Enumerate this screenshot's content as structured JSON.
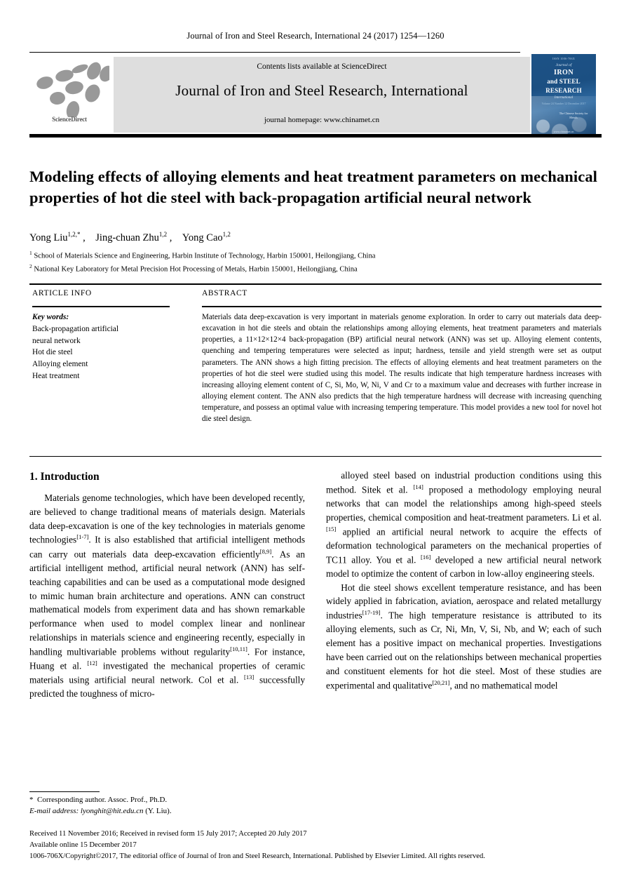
{
  "running_head": "Journal of Iron and Steel Research, International 24 (2017) 1254—1260",
  "masthead": {
    "sciencedirect_label": "ScienceDirect",
    "contents_line": "Contents lists available at ScienceDirect",
    "journal_name": "Journal of Iron and Steel Research, International",
    "homepage_line": "journal homepage: www.chinamet.cn",
    "cover": {
      "tiny_top": "ISSN 1006-706X",
      "journal_word": "Journal of",
      "line1": "IRON",
      "line2": "and STEEL",
      "line3": "RESEARCH",
      "subtitle": "International",
      "subtitle2": "Volume 24  Number 12  December 2017",
      "badge": "The Chinese Society for Metals",
      "footer": "www.chinamet.cn"
    },
    "band_color": "#dedede",
    "cover_color": "#1b4f82"
  },
  "article": {
    "title": "Modeling effects of alloying elements and heat treatment parameters on mechanical properties of hot die steel with back-propagation artificial neural network",
    "authors_html": "Yong Liu<sup>1,2,*</sup> , Jing-chuan Zhu<sup>1,2</sup> , Yong Cao<sup>1,2</sup>",
    "affiliations_html": "<sup>1</sup> School of Materials Science and Engineering, Harbin Institute of Technology, Harbin 150001, Heilongjiang, China<br><sup>2</sup> National Key Laboratory for Metal Precision Hot Processing of Metals, Harbin 150001, Heilongjiang, China"
  },
  "info_block": {
    "article_info_label": "ARTICLE INFO",
    "abstract_label": "ABSTRACT",
    "keywords_heading": "Key words:",
    "keywords": [
      "Back-propagation artificial",
      "neural network",
      "Hot die steel",
      "Alloying element",
      "Heat treatment"
    ],
    "abstract": "Materials data deep-excavation is very important in materials genome exploration. In order to carry out materials data deep-excavation in hot die steels and obtain the relationships among alloying elements, heat treatment parameters and materials properties, a 11×12×12×4 back-propagation (BP) artificial neural network (ANN) was set up. Alloying element contents, quenching and tempering temperatures were selected as input; hardness, tensile and yield strength were set as output parameters. The ANN shows a high fitting precision. The effects of alloying elements and heat treatment parameters on the properties of hot die steel were studied using this model. The results indicate that high temperature hardness increases with increasing alloying element content of C, Si, Mo, W, Ni, V and Cr to a maximum value and decreases with further increase in alloying element content. The ANN also predicts that the high temperature hardness will decrease with increasing quenching temperature, and possess an optimal value with increasing tempering temperature. This model provides a new tool for novel hot die steel design."
  },
  "body": {
    "section_heading": "1. Introduction",
    "left_paragraphs_html": [
      "Materials genome technologies, which have been developed recently, are believed to change traditional means of materials design. Materials data deep-excavation is one of the key technologies in materials genome technologies<sup>[1-7]</sup>. It is also established that artificial intelligent methods can carry out materials data deep-excavation efficiently<sup>[8,9]</sup>. As an artificial intelligent method, artificial neural network (ANN) has self-teaching capabilities and can be used as a computational mode designed to mimic human brain architecture and operations. ANN can construct mathematical models from experiment data and has shown remarkable performance when used to model complex linear and nonlinear relationships in materials science and engineering recently, especially in handling multivariable problems without regularity<sup>[10,11]</sup>. For instance, Huang et al. <sup>[12]</sup> investigated the mechanical properties of ceramic materials using artificial neural network. Col et al. <sup>[13]</sup> successfully predicted the toughness of micro-"
    ],
    "right_paragraphs_html": [
      "alloyed steel based on industrial production conditions using this method. Sitek et al. <sup>[14]</sup> proposed a methodology employing neural networks that can model the relationships among high-speed steels properties, chemical composition and heat-treatment parameters. Li et al. <sup>[15]</sup> applied an artificial neural network to acquire the effects of deformation technological parameters on the mechanical properties of TC11 alloy. You et al. <sup>[16]</sup> developed a new artificial neural network model to optimize the content of carbon in low-alloy engineering steels.",
      "Hot die steel shows excellent temperature resistance, and has been widely applied in fabrication, aviation, aerospace and related metallurgy industries<sup>[17-19]</sup>. The high temperature resistance is attributed to its alloying elements, such as Cr, Ni, Mn, V, Si, Nb, and W; each of such element has a positive impact on mechanical properties. Investigations have been carried out on the relationships between mechanical properties and constituent elements for hot die steel. Most of these studies are experimental and qualitative<sup>[20,21]</sup>, and no mathematical model"
    ]
  },
  "footer": {
    "corresponding_author": "* Corresponding author. Assoc. Prof., Ph.D.",
    "email_label": "E-mail address:",
    "email_value": "lyonghit@hit.edu.cn",
    "email_tail": "(Y. Liu).",
    "received_line": "Received 11 November 2016; Received in revised form 15 July 2017; Accepted 20 July 2017",
    "available_line": "Available online 15 December 2017",
    "copyright_line": "1006-706X/Copyright©2017, The editorial office of Journal of Iron and Steel Research, International. Published by Elsevier Limited. All rights reserved."
  }
}
